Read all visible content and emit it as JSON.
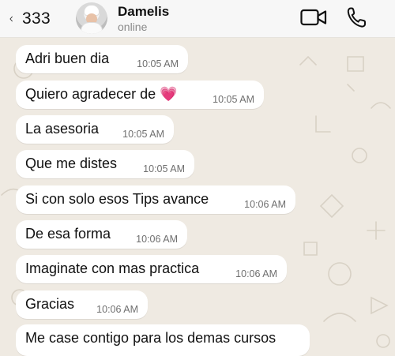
{
  "header": {
    "back_count": "333",
    "contact_name": "Damelis",
    "status": "online"
  },
  "messages": [
    {
      "text": "Adri buen dia",
      "time": "10:05 AM"
    },
    {
      "text": "Quiero agradecer de 💗",
      "time": "10:05 AM"
    },
    {
      "text": "La asesoria",
      "time": "10:05 AM"
    },
    {
      "text": "Que me distes",
      "time": "10:05 AM"
    },
    {
      "text": "Si con solo esos Tips avance",
      "time": "10:06 AM"
    },
    {
      "text": "De esa forma",
      "time": "10:06 AM"
    },
    {
      "text": "Imaginate con mas practica",
      "time": "10:06 AM"
    },
    {
      "text": "Gracias",
      "time": "10:06 AM"
    },
    {
      "text": "Me case contigo para los demas cursos",
      "time": ""
    }
  ],
  "icons": {
    "back": "chevron-left-icon",
    "video": "video-camera-icon",
    "phone": "phone-icon"
  },
  "colors": {
    "wallpaper": "#efeae2",
    "bubble": "#ffffff",
    "header": "#f7f7f7"
  }
}
